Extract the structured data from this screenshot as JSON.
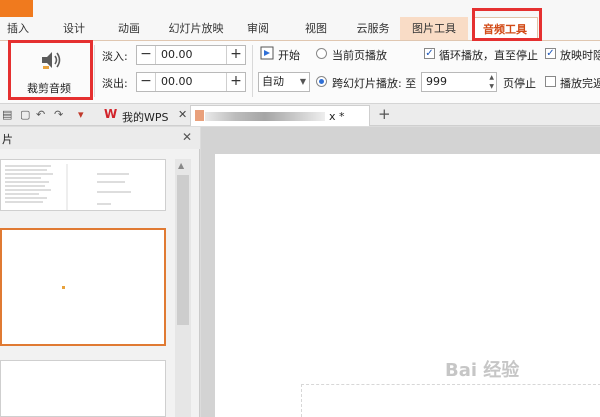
{
  "tabs": {
    "file": "",
    "insert": "插入",
    "design": "设计",
    "animation": "动画",
    "slideshow": "幻灯片放映",
    "review": "审阅",
    "view": "视图",
    "cloud": "云服务",
    "picture_tools": "图片工具",
    "audio_tools": "音频工具"
  },
  "ribbon": {
    "trim_audio_label": "裁剪音频",
    "fade_in_label": "淡入:",
    "fade_in_value": "00.00",
    "fade_out_label": "淡出:",
    "fade_out_value": "00.00",
    "start_label": "开始",
    "start_mode": "自动",
    "current_page_play": "当前页播放",
    "cross_slide_play": "跨幻灯片播放: 至",
    "cross_slide_page": "999",
    "page_stop": "页停止",
    "loop_play": "循环播放，直至停止",
    "hide_while_playing": "放映时隐",
    "rewind_after_play": "播放完返"
  },
  "doc_tabs": {
    "wps_label": "我的WPS",
    "doc_title": "x *"
  },
  "panel": {
    "title": "片"
  },
  "watermark": "Bai 经验"
}
